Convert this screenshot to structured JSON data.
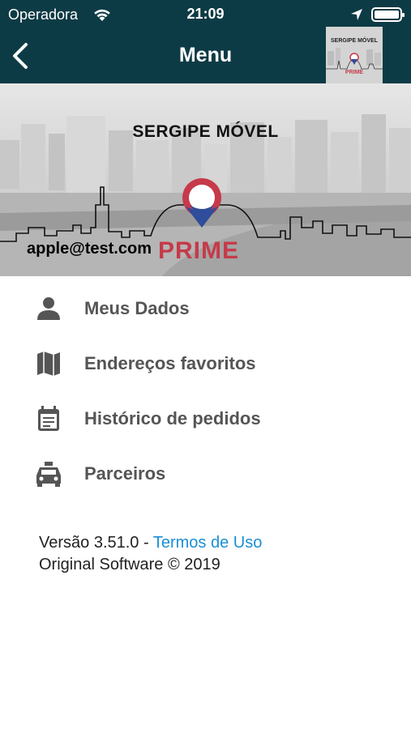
{
  "status_bar": {
    "carrier": "Operadora",
    "time": "21:09"
  },
  "header": {
    "title": "Menu",
    "back_icon": "chevron-left-icon",
    "thumbnail_text": "SERGIPE MÓVEL"
  },
  "banner": {
    "title": "SERGIPE MÓVEL",
    "logo_text": "PRIME",
    "user_email": "apple@test.com",
    "colors": {
      "logo_red": "#c63a4a",
      "logo_blue": "#2f4d9a"
    }
  },
  "menu": {
    "items": [
      {
        "label": "Meus Dados",
        "icon": "person-icon"
      },
      {
        "label": "Endereços favoritos",
        "icon": "map-icon"
      },
      {
        "label": "Histórico de pedidos",
        "icon": "calendar-list-icon"
      },
      {
        "label": "Parceiros",
        "icon": "taxi-icon"
      }
    ]
  },
  "footer": {
    "version": "Versão 3.51.0 - ",
    "terms_link": "Termos de Uso",
    "copyright": "Original Software © 2019"
  },
  "colors": {
    "header_bg": "#0d3b45",
    "link": "#1a8fd6",
    "menu_text": "#555555"
  }
}
